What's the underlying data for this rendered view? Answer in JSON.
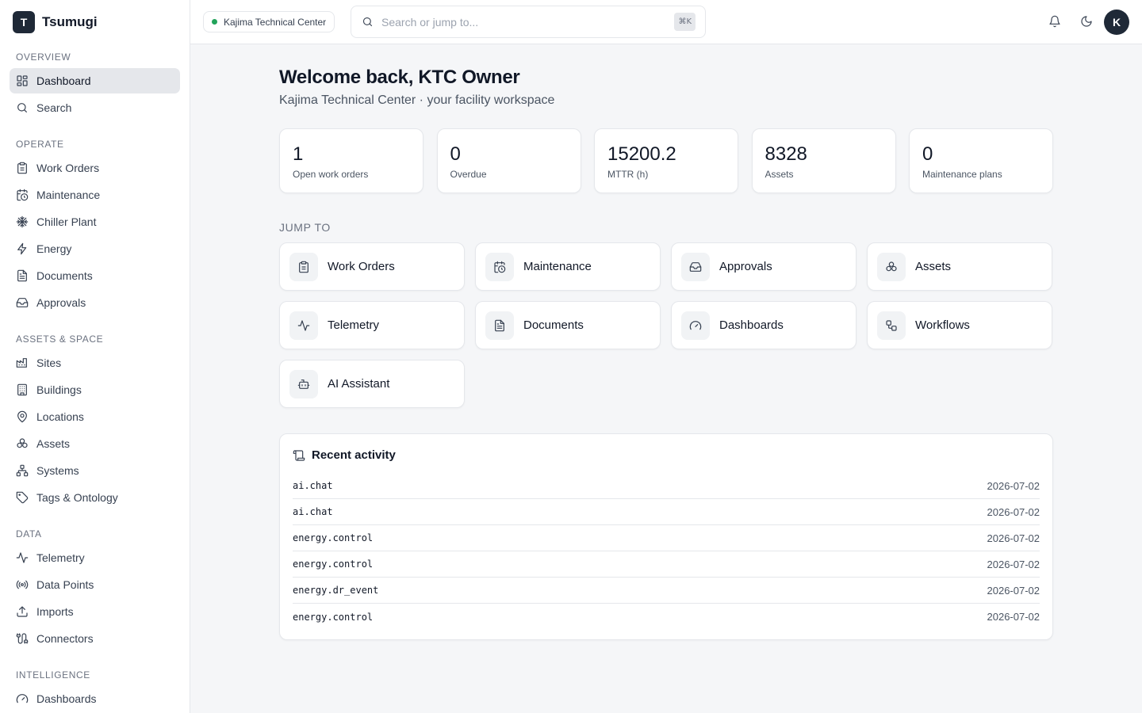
{
  "brand": {
    "logo_letter": "T",
    "name": "Tsumugi"
  },
  "sidebar": {
    "sections": [
      {
        "label": "OVERVIEW",
        "items": [
          {
            "label": "Dashboard",
            "icon": "dashboard-icon",
            "active": true
          },
          {
            "label": "Search",
            "icon": "search-icon"
          }
        ]
      },
      {
        "label": "OPERATE",
        "items": [
          {
            "label": "Work Orders",
            "icon": "clipboard-icon"
          },
          {
            "label": "Maintenance",
            "icon": "calendar-clock-icon"
          },
          {
            "label": "Chiller Plant",
            "icon": "snowflake-icon"
          },
          {
            "label": "Energy",
            "icon": "zap-icon"
          },
          {
            "label": "Documents",
            "icon": "file-text-icon"
          },
          {
            "label": "Approvals",
            "icon": "inbox-icon"
          }
        ]
      },
      {
        "label": "ASSETS & SPACE",
        "items": [
          {
            "label": "Sites",
            "icon": "factory-icon"
          },
          {
            "label": "Buildings",
            "icon": "building-icon"
          },
          {
            "label": "Locations",
            "icon": "map-pin-icon"
          },
          {
            "label": "Assets",
            "icon": "boxes-icon"
          },
          {
            "label": "Systems",
            "icon": "network-icon"
          },
          {
            "label": "Tags & Ontology",
            "icon": "tag-icon"
          }
        ]
      },
      {
        "label": "DATA",
        "items": [
          {
            "label": "Telemetry",
            "icon": "activity-icon"
          },
          {
            "label": "Data Points",
            "icon": "radio-icon"
          },
          {
            "label": "Imports",
            "icon": "upload-icon"
          },
          {
            "label": "Connectors",
            "icon": "cable-icon"
          }
        ]
      },
      {
        "label": "INTELLIGENCE",
        "items": [
          {
            "label": "Dashboards",
            "icon": "gauge-icon"
          }
        ]
      }
    ]
  },
  "topbar": {
    "site": "Kajima Technical Center",
    "site_status_color": "#22a35a",
    "search_placeholder": "Search or jump to...",
    "search_shortcut": "⌘K",
    "avatar_letter": "K"
  },
  "main": {
    "welcome": "Welcome back, KTC Owner",
    "subtitle": "Kajima Technical Center · your facility workspace",
    "stats": [
      {
        "value": "1",
        "label": "Open work orders"
      },
      {
        "value": "0",
        "label": "Overdue"
      },
      {
        "value": "15200.2",
        "label": "MTTR (h)"
      },
      {
        "value": "8328",
        "label": "Assets"
      },
      {
        "value": "0",
        "label": "Maintenance plans"
      }
    ],
    "jump_to_label": "JUMP TO",
    "jump_to": [
      {
        "label": "Work Orders",
        "icon": "clipboard-icon"
      },
      {
        "label": "Maintenance",
        "icon": "calendar-clock-icon"
      },
      {
        "label": "Approvals",
        "icon": "inbox-icon"
      },
      {
        "label": "Assets",
        "icon": "boxes-icon"
      },
      {
        "label": "Telemetry",
        "icon": "activity-icon"
      },
      {
        "label": "Documents",
        "icon": "file-text-icon"
      },
      {
        "label": "Dashboards",
        "icon": "gauge-icon"
      },
      {
        "label": "Workflows",
        "icon": "workflow-icon"
      },
      {
        "label": "AI Assistant",
        "icon": "bot-icon"
      }
    ],
    "activity": {
      "title": "Recent activity",
      "rows": [
        {
          "event": "ai.chat",
          "date": "2026-07-02"
        },
        {
          "event": "ai.chat",
          "date": "2026-07-02"
        },
        {
          "event": "energy.control",
          "date": "2026-07-02"
        },
        {
          "event": "energy.control",
          "date": "2026-07-02"
        },
        {
          "event": "energy.dr_event",
          "date": "2026-07-02"
        },
        {
          "event": "energy.control",
          "date": "2026-07-02"
        }
      ]
    }
  }
}
